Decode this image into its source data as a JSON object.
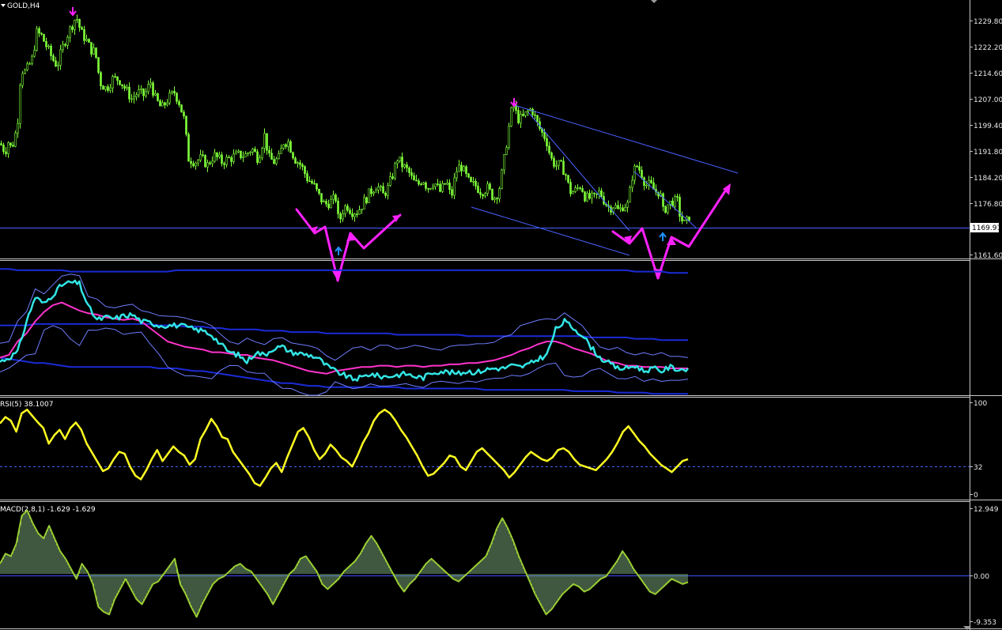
{
  "colors": {
    "background": "#000000",
    "frame": "#c8c8c8",
    "candle": "#7fff3a",
    "trendline": "#4a60ff",
    "annotation": "#ff22ff",
    "up_arrow": "#1e90ff",
    "down_arrow": "#ff22ff",
    "stoch_main": "#33e5e5",
    "stoch_signal": "#ff33cc",
    "band_outer": "#1a2bd8",
    "band_inner": "#6f7dff",
    "rsi_line": "#ffff22",
    "macd_line": "#9acd32",
    "macd_hist": "#7fb07f",
    "zero_line": "#3a4fff"
  },
  "chart_data": [
    {
      "type": "candlestick",
      "title": "GOLD,H4",
      "price_axis_ticks": [
        "1229.80",
        "1222.20",
        "1214.60",
        "1207.00",
        "1199.40",
        "1191.80",
        "1184.20",
        "1176.80",
        "1161.60"
      ],
      "current_price_label": "1169.91",
      "ylim": [
        1158.5,
        1232.5
      ],
      "current_price": 1169.91,
      "path_points": [
        [
          0,
          1192.5
        ],
        [
          6,
          1190
        ],
        [
          10,
          1193
        ],
        [
          14,
          1191
        ],
        [
          18,
          1194
        ],
        [
          22,
          1200
        ],
        [
          26,
          1215
        ],
        [
          32,
          1214
        ],
        [
          40,
          1218
        ],
        [
          46,
          1226
        ],
        [
          52,
          1225
        ],
        [
          60,
          1221
        ],
        [
          66,
          1218
        ],
        [
          72,
          1216
        ],
        [
          78,
          1221
        ],
        [
          84,
          1225
        ],
        [
          90,
          1228
        ],
        [
          96,
          1231
        ],
        [
          102,
          1226
        ],
        [
          108,
          1224
        ],
        [
          114,
          1221
        ],
        [
          120,
          1220
        ],
        [
          126,
          1211
        ],
        [
          134,
          1209
        ],
        [
          142,
          1212
        ],
        [
          150,
          1212
        ],
        [
          158,
          1209
        ],
        [
          166,
          1206
        ],
        [
          174,
          1208
        ],
        [
          182,
          1207
        ],
        [
          190,
          1211
        ],
        [
          196,
          1206
        ],
        [
          204,
          1203
        ],
        [
          212,
          1206
        ],
        [
          220,
          1208
        ],
        [
          226,
          1205
        ],
        [
          232,
          1200
        ],
        [
          238,
          1188
        ],
        [
          246,
          1187
        ],
        [
          254,
          1188
        ],
        [
          262,
          1186
        ],
        [
          270,
          1189
        ],
        [
          280,
          1187
        ],
        [
          290,
          1188
        ],
        [
          300,
          1189
        ],
        [
          310,
          1189
        ],
        [
          318,
          1191
        ],
        [
          326,
          1188
        ],
        [
          334,
          1195
        ],
        [
          340,
          1188
        ],
        [
          346,
          1187
        ],
        [
          352,
          1188
        ],
        [
          358,
          1193
        ],
        [
          364,
          1193
        ],
        [
          372,
          1188
        ],
        [
          380,
          1186
        ],
        [
          388,
          1182
        ],
        [
          396,
          1180
        ],
        [
          402,
          1177
        ],
        [
          410,
          1174
        ],
        [
          418,
          1175
        ],
        [
          424,
          1176
        ],
        [
          428,
          1168
        ],
        [
          432,
          1172
        ],
        [
          438,
          1174
        ],
        [
          444,
          1172
        ],
        [
          452,
          1172
        ],
        [
          460,
          1175
        ],
        [
          468,
          1178
        ],
        [
          476,
          1180
        ],
        [
          484,
          1177
        ],
        [
          490,
          1179
        ],
        [
          496,
          1183
        ],
        [
          502,
          1188
        ],
        [
          508,
          1186
        ],
        [
          516,
          1184
        ],
        [
          522,
          1181
        ],
        [
          528,
          1180
        ],
        [
          534,
          1182
        ],
        [
          540,
          1179
        ],
        [
          548,
          1181
        ],
        [
          556,
          1178
        ],
        [
          564,
          1181
        ],
        [
          570,
          1176
        ],
        [
          576,
          1184
        ],
        [
          582,
          1186
        ],
        [
          588,
          1183
        ],
        [
          594,
          1180
        ],
        [
          600,
          1180
        ],
        [
          608,
          1178
        ],
        [
          616,
          1179
        ],
        [
          624,
          1176
        ],
        [
          630,
          1178
        ],
        [
          636,
          1186
        ],
        [
          642,
          1196
        ],
        [
          648,
          1205
        ],
        [
          654,
          1200
        ],
        [
          660,
          1200
        ],
        [
          666,
          1202
        ],
        [
          672,
          1203
        ],
        [
          678,
          1199
        ],
        [
          684,
          1196
        ],
        [
          690,
          1194
        ],
        [
          696,
          1188
        ],
        [
          702,
          1186
        ],
        [
          708,
          1186
        ],
        [
          714,
          1184
        ],
        [
          720,
          1178
        ],
        [
          726,
          1178
        ],
        [
          734,
          1180
        ],
        [
          740,
          1176
        ],
        [
          746,
          1176
        ],
        [
          752,
          1176
        ],
        [
          758,
          1178
        ],
        [
          764,
          1175
        ],
        [
          770,
          1173
        ],
        [
          776,
          1174
        ],
        [
          782,
          1172
        ],
        [
          788,
          1174
        ],
        [
          794,
          1174
        ],
        [
          798,
          1182
        ],
        [
          804,
          1186
        ],
        [
          810,
          1184
        ],
        [
          816,
          1180
        ],
        [
          822,
          1180
        ],
        [
          828,
          1178
        ],
        [
          834,
          1178
        ],
        [
          838,
          1172
        ],
        [
          844,
          1174
        ],
        [
          850,
          1175
        ],
        [
          856,
          1175
        ],
        [
          860,
          1170
        ],
        [
          866,
          1168
        ],
        [
          872,
          1171
        ]
      ]
    },
    {
      "type": "line",
      "series": [
        {
          "role": "main",
          "values": [
            25,
            28,
            32,
            55,
            73,
            68,
            75,
            82,
            84,
            83,
            66,
            56,
            58,
            57,
            59,
            60,
            55,
            54,
            52,
            52,
            52,
            51,
            49,
            48,
            45,
            38,
            32,
            30,
            25,
            32,
            30,
            35,
            36,
            32,
            31,
            30,
            28,
            22,
            18,
            15,
            12,
            13,
            16,
            14,
            14,
            15,
            16,
            14,
            13,
            17,
            18,
            17,
            16,
            18,
            17,
            19,
            20,
            20,
            22,
            21,
            23,
            27,
            30,
            49,
            55,
            50,
            45,
            36,
            28,
            24,
            20,
            20,
            22,
            18,
            20,
            18,
            21,
            19,
            20
          ]
        },
        {
          "role": "signal",
          "values": [
            28,
            30,
            40,
            46,
            55,
            62,
            67,
            69,
            66,
            63,
            61,
            60,
            58,
            57,
            56,
            57,
            55,
            50,
            45,
            40,
            38,
            36,
            35,
            34,
            32,
            32,
            31,
            30,
            30,
            28,
            27,
            26,
            24,
            22,
            20,
            18,
            17,
            16,
            18,
            19,
            20,
            21,
            21,
            22,
            22,
            21,
            22,
            22,
            21,
            22,
            22,
            23,
            23,
            24,
            24,
            25,
            26,
            28,
            30,
            33,
            35,
            38,
            40,
            40,
            38,
            35,
            33,
            31,
            28,
            25,
            24,
            22,
            22,
            21,
            21,
            21,
            20,
            20,
            20
          ]
        }
      ],
      "bands": [
        {
          "role": "upper",
          "values": [
            94,
            94,
            93,
            93,
            93,
            93,
            93,
            93,
            92,
            92,
            92,
            92,
            92,
            92,
            92,
            92,
            92,
            92,
            92,
            92,
            93,
            93,
            93,
            93,
            93,
            93,
            93,
            93,
            93,
            93,
            93,
            93,
            93,
            93,
            93,
            93,
            93,
            93,
            93,
            93,
            93,
            93,
            93,
            93,
            93,
            93,
            93,
            93,
            93,
            93,
            93,
            93,
            93,
            93,
            93,
            93,
            93,
            93,
            93,
            93,
            93,
            93,
            93,
            93,
            93,
            93,
            93,
            93,
            93,
            93,
            93,
            93,
            92,
            92,
            92,
            92,
            91,
            91,
            91
          ]
        },
        {
          "role": "middle",
          "values": [
            52,
            52,
            52,
            52,
            53,
            53,
            53,
            53,
            53,
            53,
            53,
            53,
            53,
            53,
            53,
            53,
            53,
            53,
            52,
            52,
            52,
            51,
            51,
            51,
            50,
            50,
            49,
            49,
            49,
            49,
            48,
            48,
            48,
            47,
            47,
            47,
            47,
            46,
            46,
            46,
            46,
            46,
            46,
            46,
            46,
            45,
            45,
            45,
            45,
            45,
            45,
            45,
            45,
            44,
            44,
            44,
            44,
            44,
            44,
            44,
            44,
            44,
            44,
            44,
            44,
            44,
            44,
            43,
            43,
            43,
            43,
            43,
            42,
            42,
            42,
            41,
            41,
            41,
            41
          ]
        },
        {
          "role": "lower",
          "values": [
            28,
            27,
            26,
            25,
            24,
            24,
            23,
            22,
            21,
            21,
            21,
            21,
            21,
            21,
            21,
            21,
            21,
            21,
            20,
            20,
            20,
            19,
            18,
            18,
            17,
            16,
            15,
            14,
            13,
            12,
            11,
            10,
            9,
            9,
            8,
            7,
            7,
            6,
            6,
            6,
            6,
            6,
            6,
            6,
            6,
            6,
            5,
            5,
            5,
            5,
            5,
            5,
            5,
            5,
            5,
            4,
            4,
            4,
            4,
            4,
            4,
            4,
            4,
            4,
            4,
            3,
            3,
            3,
            3,
            3,
            2,
            2,
            2,
            2,
            1,
            1,
            1,
            1,
            1
          ]
        }
      ],
      "ylim": [
        0,
        100
      ]
    },
    {
      "type": "line",
      "title": "RSI(5) 38.1007",
      "axis_ticks": [
        "100",
        "32",
        "0"
      ],
      "ylim": [
        0,
        100
      ],
      "level": 32,
      "values": [
        77,
        84,
        80,
        68,
        88,
        92,
        85,
        78,
        72,
        55,
        64,
        70,
        60,
        72,
        78,
        70,
        55,
        45,
        35,
        25,
        28,
        38,
        46,
        44,
        30,
        20,
        16,
        26,
        38,
        48,
        36,
        44,
        52,
        46,
        42,
        32,
        38,
        60,
        70,
        82,
        74,
        62,
        60,
        46,
        38,
        30,
        22,
        12,
        9,
        18,
        28,
        34,
        24,
        40,
        54,
        68,
        72,
        62,
        48,
        38,
        44,
        54,
        48,
        40,
        36,
        30,
        42,
        56,
        66,
        80,
        88,
        92,
        88,
        80,
        70,
        62,
        52,
        42,
        30,
        20,
        22,
        28,
        34,
        42,
        40,
        30,
        26,
        36,
        46,
        50,
        44,
        38,
        32,
        26,
        18,
        24,
        32,
        40,
        46,
        42,
        38,
        36,
        40,
        48,
        50,
        46,
        38,
        32,
        30,
        28,
        26,
        32,
        38,
        46,
        56,
        68,
        74,
        66,
        58,
        52,
        44,
        38,
        32,
        28,
        24,
        30,
        36,
        38
      ]
    },
    {
      "type": "line",
      "title": "MACD(2,8,1) -1.629 -1.629",
      "axis_ticks": [
        "12.949",
        "0.00",
        "-9.353"
      ],
      "ylim": [
        -9.353,
        12.949
      ],
      "values": [
        2.0,
        4.0,
        3.5,
        6.0,
        11.5,
        12.5,
        10.0,
        8.0,
        7.0,
        9.5,
        7.0,
        4.5,
        3.0,
        1.0,
        -1.0,
        2.0,
        0.5,
        -2.0,
        -6.5,
        -7.5,
        -8.0,
        -5.0,
        -3.0,
        -1.0,
        -3.0,
        -5.0,
        -6.0,
        -4.0,
        -2.0,
        -1.5,
        0.0,
        1.5,
        3.0,
        -2.0,
        -4.0,
        -6.5,
        -8.5,
        -6.0,
        -4.0,
        -2.0,
        -1.0,
        -0.5,
        0.5,
        1.5,
        2.0,
        1.0,
        0.5,
        -1.0,
        -2.5,
        -4.0,
        -6.0,
        -4.0,
        -2.0,
        0.0,
        1.0,
        3.0,
        3.5,
        2.0,
        0.5,
        -2.0,
        -3.0,
        -2.0,
        -1.0,
        0.5,
        1.5,
        2.5,
        4.0,
        6.0,
        7.5,
        6.0,
        4.0,
        2.0,
        0.0,
        -2.0,
        -3.5,
        -2.0,
        -1.0,
        0.5,
        2.0,
        3.0,
        2.0,
        1.0,
        0.0,
        -1.0,
        -1.5,
        -0.5,
        0.5,
        1.5,
        2.5,
        3.5,
        6.0,
        9.0,
        11.0,
        9.0,
        6.5,
        3.5,
        1.0,
        -1.5,
        -4.0,
        -6.0,
        -8.0,
        -7.0,
        -5.5,
        -4.0,
        -3.0,
        -2.0,
        -2.5,
        -3.5,
        -3.0,
        -2.0,
        -1.0,
        -0.5,
        1.0,
        2.5,
        4.5,
        3.0,
        1.0,
        -0.5,
        -2.0,
        -3.5,
        -4.0,
        -3.0,
        -2.0,
        -1.0,
        -1.5,
        -2.0,
        -1.63
      ]
    }
  ]
}
